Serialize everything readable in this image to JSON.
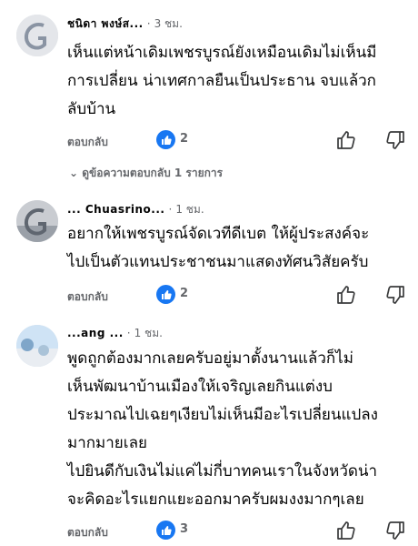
{
  "comments": [
    {
      "author": "ชนิดา พงษ์ส...",
      "time": "3 ชม.",
      "lines": [
        "เห็นแต่หน้าเดิมเพชรบูรณ์ยังเหมือนเดิมไม่เห็นมี",
        "การเปลี่ยน น่าเทศกาลยืนเป็นประธาน จบแล้วก",
        "ลับบ้าน"
      ],
      "reply_label": "ตอบกลับ",
      "likes": "2",
      "view_replies": "ดูข้อความตอบกลับ 1 รายการ"
    },
    {
      "author": "... Chuasrino...",
      "time": "1 ชม.",
      "lines": [
        "อยากให้เพชรบูรณ์จัดเวทีดีเบต ให้ผู้ประสงค์จะ",
        "ไปเป็นตัวแทนประชาชนมาแสดงทัศนวิสัยครับ"
      ],
      "reply_label": "ตอบกลับ",
      "likes": "2"
    },
    {
      "author": "...ang ...",
      "time": "1 ชม.",
      "lines": [
        "พูดถูกต้องมากเลยครับอยู่มาตั้งนานแล้วก็ไม่",
        "เห็นพัฒนาบ้านเมืองให้เจริญเลยกินแต่งบ",
        "ประมาณไปเฉยๆเงียบไม่เห็นมีอะไรเปลี่ยนแปลง",
        "มากมายเลย",
        "ไปยินดีกับเงินไม่แค่ไม่กี่บาทคนเราในจังหวัดน่า",
        "จะคิดอะไรแยกแยะออกมาครับผมงงมากๆเลย"
      ],
      "reply_label": "ตอบกลับ",
      "likes": "3"
    }
  ],
  "colors": {
    "like_blue": "#1877f2",
    "meta_gray": "#65676b",
    "text": "#050505"
  },
  "icons": [
    "like-icon",
    "thumbs-up-icon",
    "thumbs-down-icon",
    "chevron-down-icon"
  ]
}
